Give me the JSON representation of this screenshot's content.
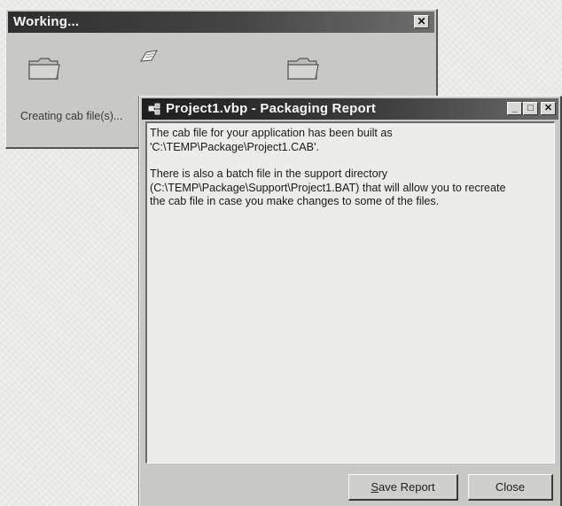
{
  "working_dialog": {
    "title": "Working...",
    "close_glyph": "✕",
    "status_text": "Creating cab file(s)...",
    "icons": [
      "folder-icon",
      "flying-document-icon",
      "folder-icon"
    ]
  },
  "report_dialog": {
    "title": "Project1.vbp - Packaging Report",
    "app_icon": "project-icon",
    "minimize_glyph": "_",
    "maximize_glyph": "□",
    "close_glyph": "✕",
    "message": {
      "paragraph1_line1": "The cab file for your application has been built as",
      "paragraph1_line2": "'C:\\TEMP\\Package\\Project1.CAB'.",
      "paragraph2_line1": "There is also a batch file in the support directory",
      "paragraph2_line2": "(C:\\TEMP\\Package\\Support\\Project1.BAT) that will allow you to recreate",
      "paragraph2_line3": "the cab file in case you make changes to some of the files."
    },
    "buttons": {
      "save_report": "Save Report",
      "close": "Close"
    }
  },
  "colors": {
    "titlebar_dark": "#2e2e2e",
    "dialog_face": "#c8c8c4",
    "text_area": "#ececea"
  }
}
